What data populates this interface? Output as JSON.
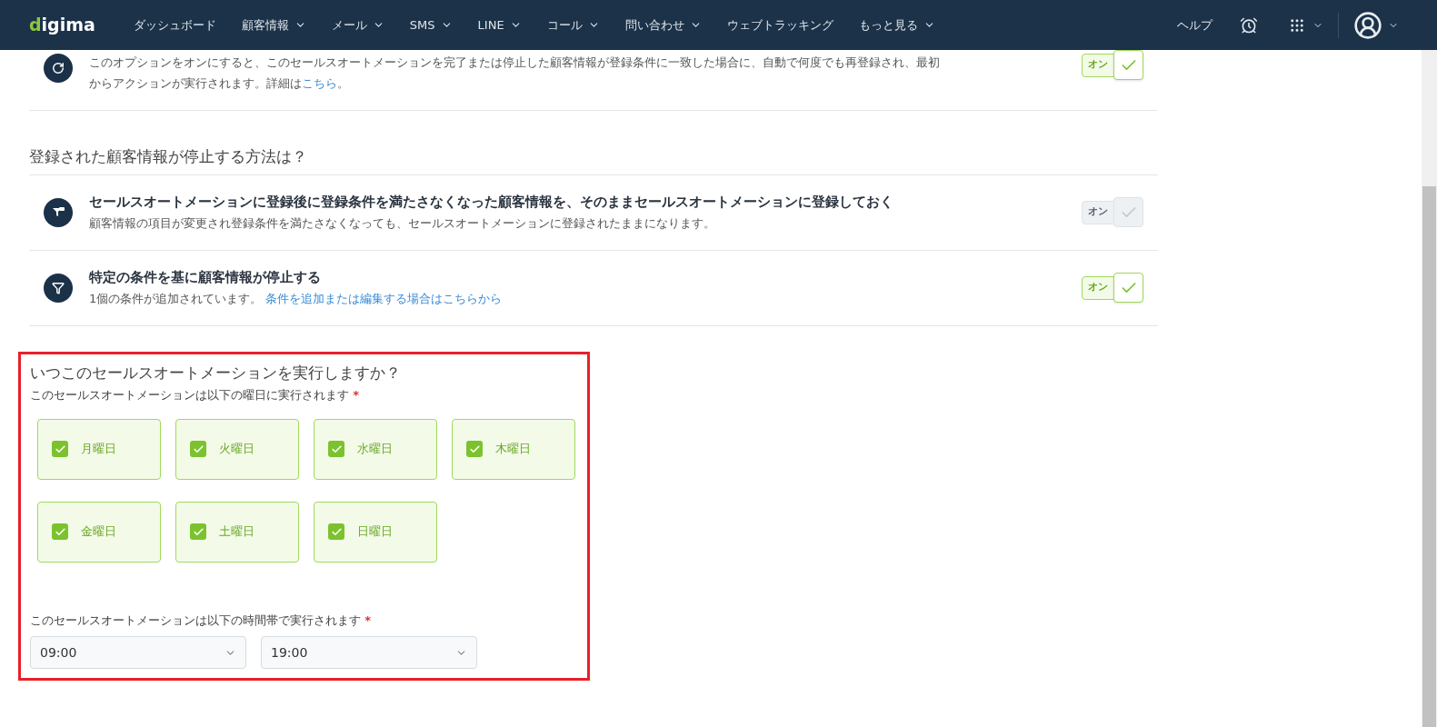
{
  "navbar": {
    "logo": "digima",
    "items": [
      {
        "label": "ダッシュボード",
        "dropdown": false
      },
      {
        "label": "顧客情報",
        "dropdown": true
      },
      {
        "label": "メール",
        "dropdown": true
      },
      {
        "label": "SMS",
        "dropdown": true
      },
      {
        "label": "LINE",
        "dropdown": true
      },
      {
        "label": "コール",
        "dropdown": true
      },
      {
        "label": "問い合わせ",
        "dropdown": true
      },
      {
        "label": "ウェブトラッキング",
        "dropdown": false
      },
      {
        "label": "もっと見る",
        "dropdown": true
      }
    ],
    "help": "ヘルプ"
  },
  "reentry_option": {
    "description": "このオプションをオンにすると、このセールスオートメーションを完了または停止した顧客情報が登録条件に一致した場合に、自動で何度でも再登録され、最初からアクションが実行されます。詳細は",
    "link": "こちら",
    "suffix": "。",
    "toggle_label": "オン",
    "on": true
  },
  "stop_section": {
    "heading": "登録された顧客情報が停止する方法は？",
    "options": [
      {
        "kind": "keep",
        "title": "セールスオートメーションに登録後に登録条件を満たさなくなった顧客情報を、そのままセールスオートメーションに登録しておく",
        "description": "顧客情報の項目が変更され登録条件を満たさなくなっても、セールスオートメーションに登録されたままになります。",
        "toggle_label": "オン",
        "on": false
      },
      {
        "kind": "filter",
        "title": "特定の条件を基に顧客情報が停止する",
        "description": "1個の条件が追加されています。",
        "link": "条件を追加または編集する場合はこちらから",
        "toggle_label": "オン",
        "on": true
      }
    ]
  },
  "schedule": {
    "heading": "いつこのセールスオートメーションを実行しますか？",
    "days_label": "このセールスオートメーションは以下の曜日に実行されます",
    "required_mark": "*",
    "days": [
      {
        "label": "月曜日",
        "checked": true
      },
      {
        "label": "火曜日",
        "checked": true
      },
      {
        "label": "水曜日",
        "checked": true
      },
      {
        "label": "木曜日",
        "checked": true
      },
      {
        "label": "金曜日",
        "checked": true
      },
      {
        "label": "土曜日",
        "checked": true
      },
      {
        "label": "日曜日",
        "checked": true
      }
    ],
    "time_label": "このセールスオートメーションは以下の時間帯で実行されます",
    "time_required_mark": "*",
    "start_time": "09:00",
    "end_time": "19:00"
  }
}
